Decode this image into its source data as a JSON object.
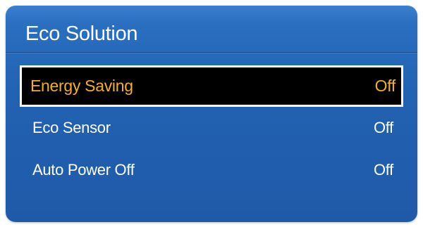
{
  "menu": {
    "title": "Eco Solution",
    "items": [
      {
        "label": "Energy Saving",
        "value": "Off",
        "selected": true
      },
      {
        "label": "Eco Sensor",
        "value": "Off",
        "selected": false
      },
      {
        "label": "Auto Power Off",
        "value": "Off",
        "selected": false
      }
    ]
  },
  "colors": {
    "panel_background": "#2262b2",
    "selected_background": "#000000",
    "selected_border": "#ffffff",
    "selected_text": "#f5b11c",
    "text": "#ffffff"
  }
}
